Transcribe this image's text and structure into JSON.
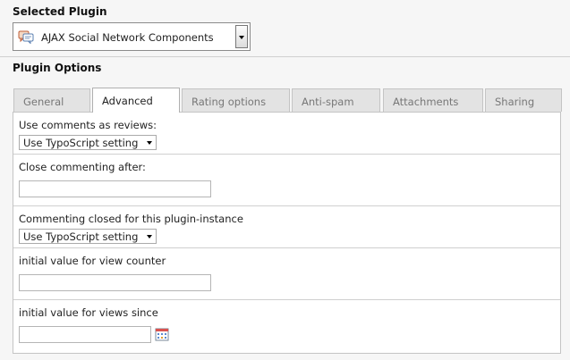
{
  "selected_plugin": {
    "heading": "Selected Plugin",
    "value": "AJAX Social Network Components",
    "icon": "plugin-comment-icon"
  },
  "plugin_options": {
    "heading": "Plugin Options",
    "tabs": [
      {
        "label": "General",
        "active": false
      },
      {
        "label": "Advanced",
        "active": true
      },
      {
        "label": "Rating options",
        "active": false
      },
      {
        "label": "Anti-spam",
        "active": false
      },
      {
        "label": "Attachments",
        "active": false
      },
      {
        "label": "Sharing",
        "active": false
      }
    ],
    "fields": {
      "use_comments_as_reviews": {
        "label": "Use comments as reviews:",
        "value": "Use TypoScript setting"
      },
      "close_commenting_after": {
        "label": "Close commenting after:",
        "value": ""
      },
      "commenting_closed": {
        "label": "Commenting closed for this plugin-instance",
        "value": "Use TypoScript setting"
      },
      "view_counter": {
        "label": "initial value for view counter",
        "value": ""
      },
      "views_since": {
        "label": "initial value for views since",
        "value": ""
      }
    }
  }
}
